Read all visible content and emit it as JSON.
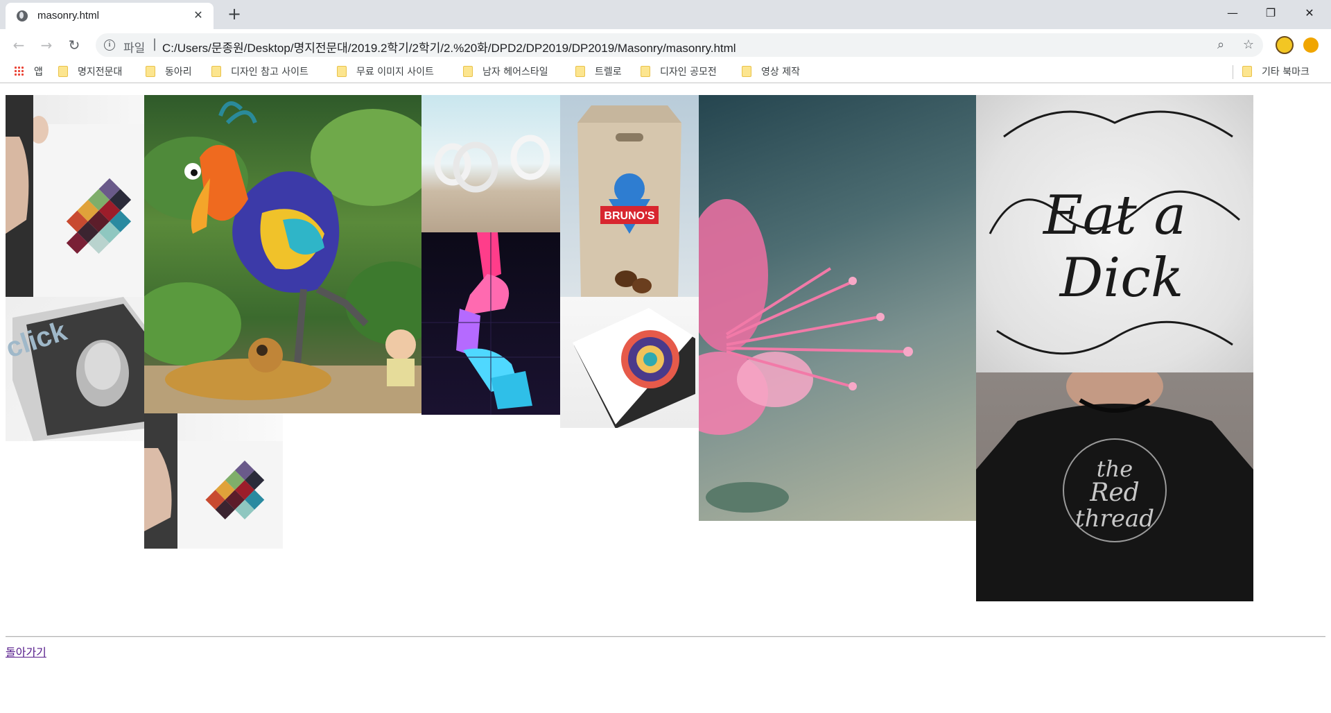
{
  "tab": {
    "title": "masonry.html"
  },
  "window": {
    "minimize": "—",
    "restore": "❐",
    "close": "✕"
  },
  "omnibox": {
    "scheme_label": "파일",
    "url": "C:/Users/문종원/Desktop/명지전문대/2019.2학기/2학기/2.%20화/DPD2/DP2019/DP2019/Masonry/masonry.html"
  },
  "bookmarks": {
    "apps": "앱",
    "items": [
      "명지전문대",
      "동아리",
      "디자인 참고 사이트",
      "무료 이미지 사이트",
      "남자 헤어스타일",
      "트렐로",
      "디자인 공모전",
      "영상 제작"
    ],
    "other": "기타 북마크"
  },
  "page": {
    "back_link": "돌아가기",
    "images": [
      {
        "name": "poster-colour-swatches",
        "desc": "poster with colour swatches"
      },
      {
        "name": "kevin-bird-jungle",
        "desc": "cartoon bird in jungle"
      },
      {
        "name": "white-rings-sculpture",
        "desc": "white rings on sand"
      },
      {
        "name": "brunos-coffee-bag",
        "desc": "Bruno's coffee bag"
      },
      {
        "name": "pink-flower-macro",
        "desc": "pink flower close up"
      },
      {
        "name": "eat-a-dick-lettering",
        "desc": "script lettering"
      },
      {
        "name": "click-magazine",
        "desc": "magazine cover"
      },
      {
        "name": "neon-ribbon-type",
        "desc": "neon ribbon letters"
      },
      {
        "name": "book-cover-illustration",
        "desc": "illustrated book"
      },
      {
        "name": "red-thread-tshirt",
        "desc": "black t-shirt with lettering"
      },
      {
        "name": "poster-colour-swatches-2",
        "desc": "poster with colour swatches"
      }
    ]
  }
}
